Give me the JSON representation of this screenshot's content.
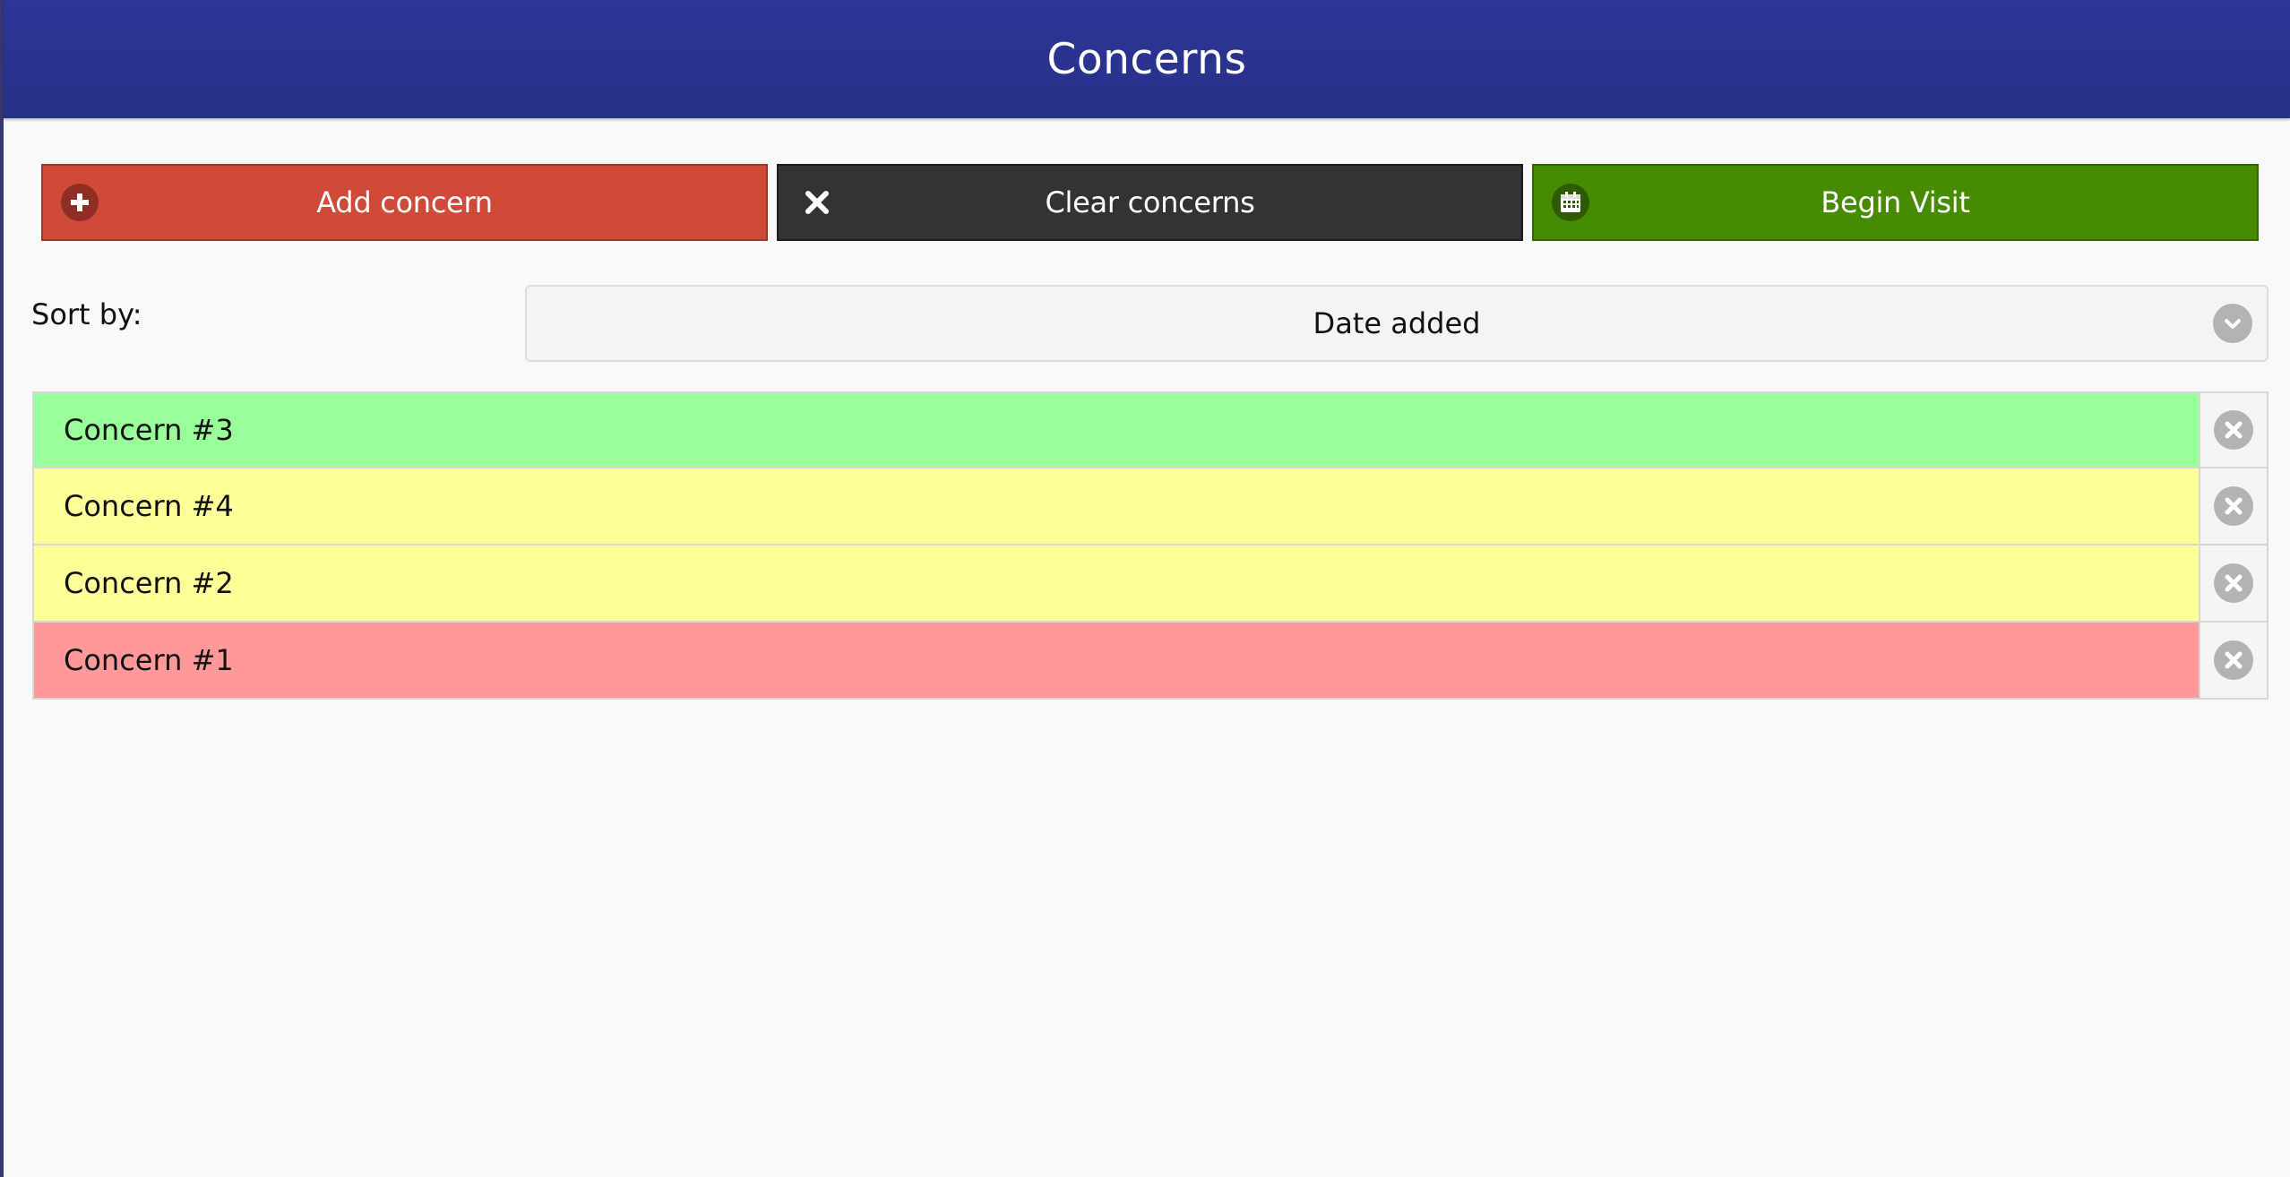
{
  "header": {
    "title": "Concerns"
  },
  "toolbar": {
    "add_label": "Add concern",
    "clear_label": "Clear concerns",
    "visit_label": "Begin Visit",
    "add_color": "#d04a3a",
    "clear_color": "#333333",
    "visit_color": "#478b03",
    "add_icon": "plus-circle-icon",
    "clear_icon": "close-icon",
    "visit_icon": "calendar-icon"
  },
  "sort": {
    "label": "Sort by:",
    "selected": "Date added",
    "icon": "chevron-down-icon"
  },
  "concerns": [
    {
      "label": "Concern #3",
      "color": "#99ff99",
      "remove_icon": "remove-circle-icon"
    },
    {
      "label": "Concern #4",
      "color": "#ffff99",
      "remove_icon": "remove-circle-icon"
    },
    {
      "label": "Concern #2",
      "color": "#ffff99",
      "remove_icon": "remove-circle-icon"
    },
    {
      "label": "Concern #1",
      "color": "#ff9999",
      "remove_icon": "remove-circle-icon"
    }
  ]
}
